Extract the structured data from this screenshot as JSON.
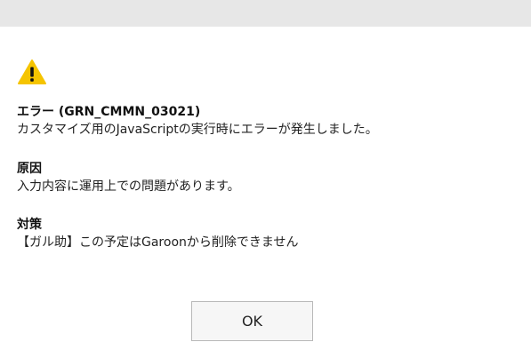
{
  "dialog": {
    "icon": "warning-icon",
    "icon_color": "#f5c400",
    "error": {
      "heading": "エラー (GRN_CMMN_03021)",
      "message": "カスタマイズ用のJavaScriptの実行時にエラーが発生しました。"
    },
    "cause": {
      "heading": "原因",
      "message": "入力内容に運用上での問題があります。"
    },
    "measure": {
      "heading": "対策",
      "message": "【ガル助】この予定はGaroonから削除できません"
    },
    "ok_label": "OK"
  }
}
